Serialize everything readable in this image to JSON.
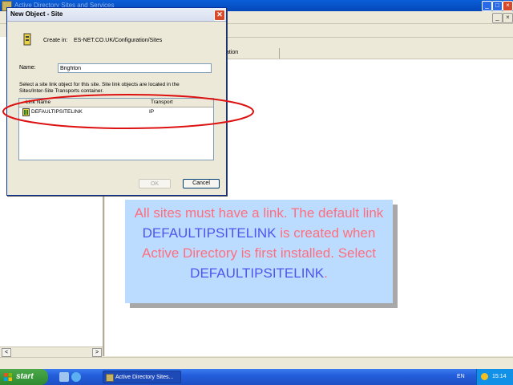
{
  "mmc": {
    "title": "Active Directory Sites and Services",
    "column_header": "ation",
    "scroll_left": "<",
    "scroll_right": ">"
  },
  "dialog": {
    "title": "New Object - Site",
    "close_glyph": "✕",
    "create_in_label": "Create in:",
    "create_in_path": "ES-NET.CO.UK/Configuration/Sites",
    "name_label": "Name:",
    "name_value": "Brighton",
    "description": "Select a site link object for this site. Site link objects are located in the Sites/Inter-Site Transports container.",
    "list": {
      "headers": [
        "Link Name",
        "Transport"
      ],
      "rows": [
        {
          "name": "DEFAULTIPSITELINK",
          "transport": "IP"
        }
      ]
    },
    "ok_label": "OK",
    "cancel_label": "Cancel"
  },
  "caption": {
    "part1": "All sites must have a link. The default link ",
    "link1": "DEFAULTIPSITELINK",
    "part2": " is created when Active Directory is first installed. Select ",
    "link2": "DEFAULTIPSITELINK",
    "part3": "."
  },
  "taskbar": {
    "start_label": "start",
    "task_label": "Active Directory Sites...",
    "language": "EN",
    "clock": "15:14"
  },
  "colors": {
    "caption_bg": "#bcdcff",
    "caption_text": "#ff6e7e",
    "caption_highlight": "#4e54ee",
    "highlight_ellipse": "#dd1111"
  }
}
